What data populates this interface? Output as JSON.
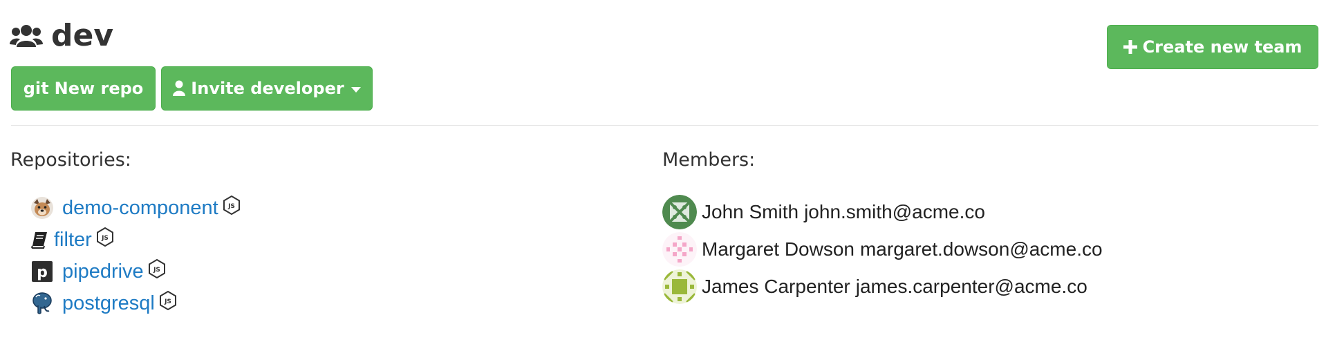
{
  "team": {
    "name": "dev",
    "icon": "users-group-icon"
  },
  "toolbar": {
    "new_repo_prefix": "git",
    "new_repo_label": "New repo",
    "invite_label": "Invite developer",
    "create_team_label": "Create new team"
  },
  "repositories": {
    "heading": "Repositories:",
    "items": [
      {
        "name": "demo-component",
        "avatar": "dog-avatar",
        "badge": "nodejs-icon"
      },
      {
        "name": "filter",
        "avatar": "book-icon",
        "badge": "nodejs-icon"
      },
      {
        "name": "pipedrive",
        "avatar": "pipedrive-logo",
        "badge": "nodejs-icon"
      },
      {
        "name": "postgresql",
        "avatar": "postgresql-elephant-logo",
        "badge": "nodejs-icon"
      }
    ]
  },
  "members": {
    "heading": "Members:",
    "items": [
      {
        "name": "John Smith",
        "email": "john.smith@acme.co",
        "avatar_color": "#4f8a4f"
      },
      {
        "name": "Margaret Dowson",
        "email": "margaret.dowson@acme.co",
        "avatar_color": "#f4a6c8"
      },
      {
        "name": "James Carpenter",
        "email": "james.carpenter@acme.co",
        "avatar_color": "#9ab83a"
      }
    ]
  },
  "colors": {
    "button_green": "#5cb85c",
    "link_blue": "#1e7bc4",
    "text_dark": "#333333"
  }
}
